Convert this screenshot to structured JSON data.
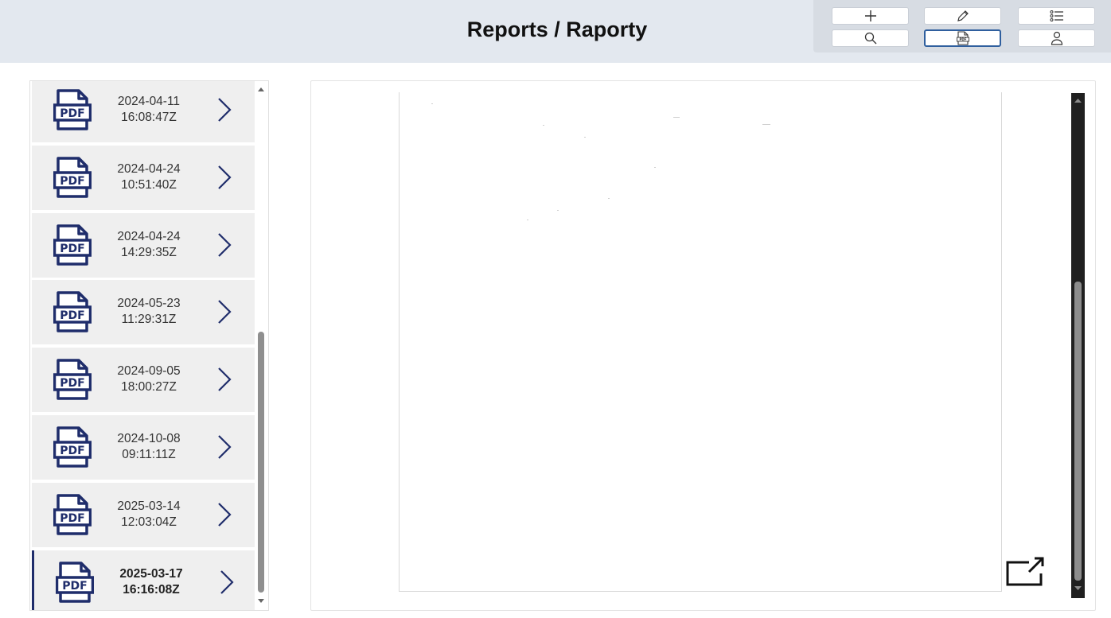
{
  "header": {
    "title": "Reports / Raporty"
  },
  "toolbar": {
    "buttons": [
      {
        "icon": "plus-icon"
      },
      {
        "icon": "pencil-icon"
      },
      {
        "icon": "list-icon"
      },
      {
        "icon": "search-icon"
      },
      {
        "icon": "pdf-file-icon",
        "active": true
      },
      {
        "icon": "user-icon"
      }
    ]
  },
  "reports": {
    "items": [
      {
        "date": "2024-04-11",
        "time": "16:08:47Z"
      },
      {
        "date": "2024-04-24",
        "time": "10:51:40Z"
      },
      {
        "date": "2024-04-24",
        "time": "14:29:35Z"
      },
      {
        "date": "2024-05-23",
        "time": "11:29:31Z"
      },
      {
        "date": "2024-09-05",
        "time": "18:00:27Z"
      },
      {
        "date": "2024-10-08",
        "time": "09:11:11Z"
      },
      {
        "date": "2025-03-14",
        "time": "12:03:04Z"
      },
      {
        "date": "2025-03-17",
        "time": "16:16:08Z",
        "selected": true
      }
    ],
    "icon_label": "PDF"
  },
  "colors": {
    "header_bg": "#e3e8ef",
    "accent": "#1f2d6b",
    "active_border": "#2f5f9e",
    "item_bg": "#efefef"
  }
}
